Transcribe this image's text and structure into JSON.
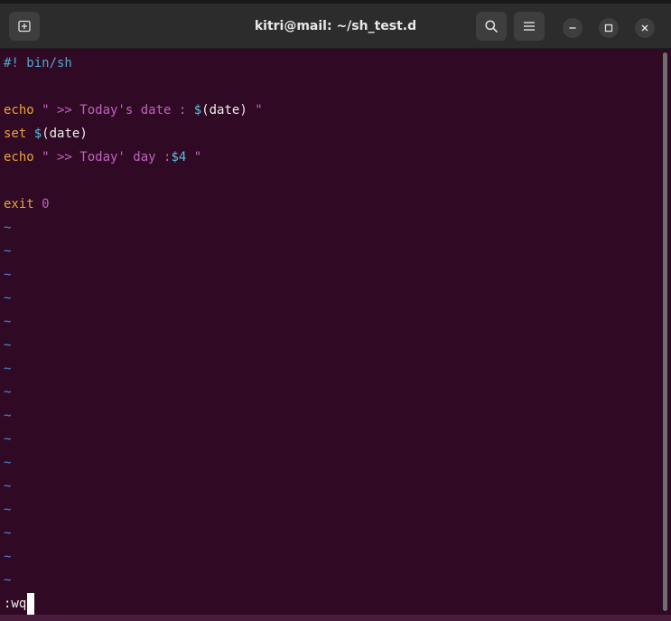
{
  "window": {
    "title": "kitri@mail: ~/sh_test.d"
  },
  "icons": {
    "new_tab": "new-tab-icon",
    "search": "search-icon",
    "menu": "hamburger-menu-icon",
    "minimize": "minimize-icon",
    "maximize": "maximize-icon",
    "close": "close-icon"
  },
  "colors": {
    "terminal_bg": "#300a24",
    "titlebar_bg": "#2c2c2c",
    "shebang": "#4ea8cc",
    "keyword": "#e8a33b",
    "string": "#c062c0",
    "variable": "#56c0e0",
    "tilde": "#4a8bd8"
  },
  "editor": {
    "shebang": "#! bin/sh",
    "line3": {
      "cmd": "echo",
      "str1": " \" >> Today's date : ",
      "dollar": "$",
      "paren_open": "(",
      "sub": "date",
      "paren_close": ")",
      "str2": " \""
    },
    "line4": {
      "cmd": "set",
      "dollar": " $",
      "paren_open": "(",
      "sub": "date",
      "paren_close": ")"
    },
    "line5": {
      "cmd": "echo",
      "str1": " \" >> Today' day :",
      "var": "$4",
      "str2": " \""
    },
    "line7": {
      "cmd": "exit",
      "arg": " 0"
    },
    "tilde": "~",
    "command_line": ":wq"
  }
}
